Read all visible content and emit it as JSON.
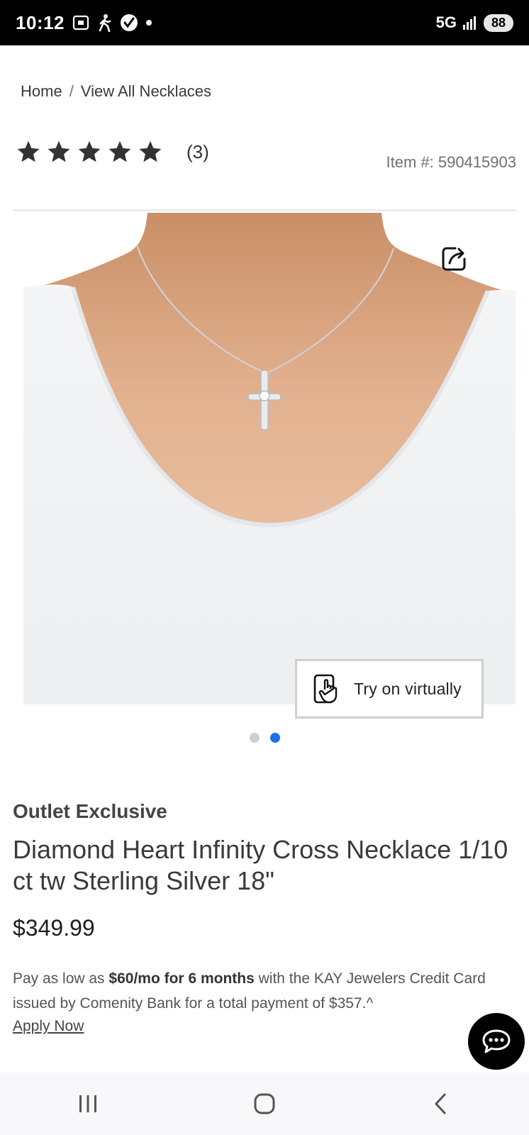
{
  "status_bar": {
    "time": "10:12",
    "network": "5G",
    "battery": "88",
    "icons": [
      "screenshot-icon",
      "walking-icon",
      "verified-check-icon",
      "dot-icon",
      "signal-bars-icon"
    ]
  },
  "breadcrumb": {
    "items": [
      "Home",
      "View All Necklaces"
    ],
    "separator": "/"
  },
  "rating": {
    "stars": 5,
    "filled": 5,
    "review_count": "(3)",
    "star_color": "#333333"
  },
  "item_number": "Item #: 590415903",
  "product_image": {
    "share_icon": "share-icon",
    "try_on_label": "Try on virtually",
    "try_on_icon": "hand-tap-phone-icon"
  },
  "carousel": {
    "total": 2,
    "active_index": 1,
    "active_color": "#1a73e8"
  },
  "product": {
    "badge": "Outlet Exclusive",
    "title": "Diamond Heart Infinity Cross Necklace 1/10 ct tw Sterling Silver 18\"",
    "price": "$349.99"
  },
  "financing": {
    "prefix": "Pay as low as ",
    "highlight": "$60/mo for 6 months",
    "suffix": " with the KAY Jewelers Credit Card issued by Comenity Bank for a total payment of $357.^",
    "apply_label": "Apply Now"
  },
  "chat": {
    "icon": "chat-bubble-icon"
  },
  "nav_bar": {
    "buttons": [
      "recent-apps-icon",
      "home-icon",
      "back-icon"
    ]
  }
}
